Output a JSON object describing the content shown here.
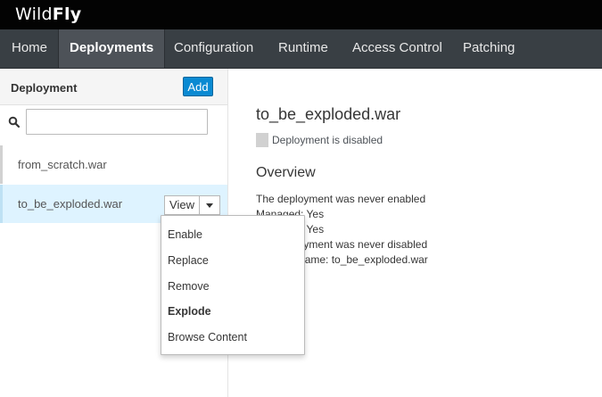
{
  "brand": {
    "light": "Wild",
    "bold": "Fly"
  },
  "nav": [
    {
      "label": "Home"
    },
    {
      "label": "Deployments"
    },
    {
      "label": "Configuration"
    },
    {
      "label": "Runtime"
    },
    {
      "label": "Access Control"
    },
    {
      "label": "Patching"
    }
  ],
  "sidebar": {
    "title": "Deployment",
    "add_label": "Add",
    "filter": {
      "value": "",
      "placeholder": ""
    },
    "items": [
      {
        "label": "from_scratch.war"
      },
      {
        "label": "to_be_exploded.war"
      }
    ],
    "view_label": "View"
  },
  "main": {
    "title": "to_be_exploded.war",
    "status": "Deployment is disabled",
    "overview_title": "Overview",
    "lines": [
      "The deployment was never enabled",
      "Managed: Yes",
      "Exploded: Yes",
      "The deployment was never disabled",
      "Runtime name: to_be_exploded.war"
    ]
  },
  "dropdown": {
    "items": [
      {
        "label": "Enable"
      },
      {
        "label": "Replace"
      },
      {
        "label": "Remove"
      },
      {
        "label": "Explode"
      },
      {
        "label": "Browse Content"
      }
    ]
  },
  "colors": {
    "brandbar": "#030303",
    "nav": "#393f44",
    "nav_active": "#4d5258",
    "primary": "#0a8ad2",
    "selected_row": "#def3ff"
  }
}
